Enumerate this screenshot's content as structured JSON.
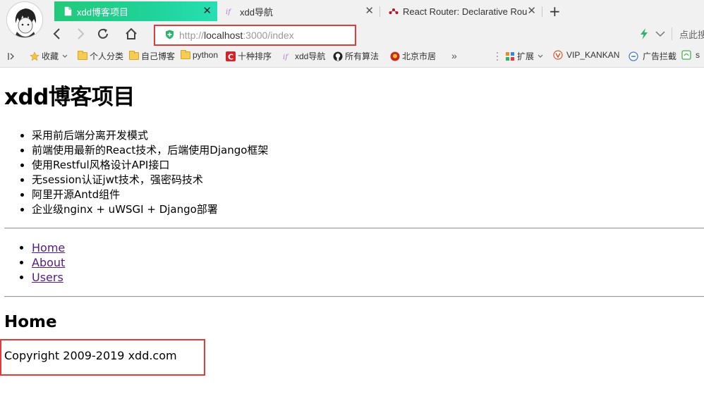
{
  "browser": {
    "tabs": [
      {
        "label": "xdd博客项目",
        "active": true
      },
      {
        "label": "xdd导航",
        "active": false
      },
      {
        "label": "React Router: Declarative Rou",
        "active": false
      }
    ],
    "tab_close_glyph": "✕",
    "new_tab_glyph": "+",
    "address": {
      "scheme": "http://",
      "host": "localhost",
      "rest": ":3000/index"
    },
    "search_hint": "点此搜",
    "bookmarks": [
      {
        "label": "收藏",
        "icon": "star-icon"
      },
      {
        "label": "个人分类",
        "icon": "folder-icon"
      },
      {
        "label": "自己博客",
        "icon": "folder-icon"
      },
      {
        "label": "python",
        "icon": "folder-icon"
      },
      {
        "label": "十种排序",
        "icon": "c-logo-icon"
      },
      {
        "label": "xdd导航",
        "icon": "if-logo-icon"
      },
      {
        "label": "所有算法",
        "icon": "github-icon"
      },
      {
        "label": "北京市居",
        "icon": "emblem-icon"
      },
      {
        "label": "»",
        "icon": "more-icon"
      },
      {
        "label": "扩展",
        "icon": "extensions-icon"
      },
      {
        "label": "VIP_KANKAN",
        "icon": "v-icon"
      },
      {
        "label": "广告拦截",
        "icon": "adblock-icon"
      },
      {
        "label": "s",
        "icon": "green-ext-icon"
      }
    ],
    "colors": {
      "active_tab": "#22c97a",
      "highlight_box": "#e33a3a",
      "visited_link": "#551a8b"
    }
  },
  "page": {
    "title": "xdd博客项目",
    "features": [
      "采用前后端分离开发模式",
      "前端使用最新的React技术，后端使用Django框架",
      "使用Restful风格设计API接口",
      "无session认证jwt技术，强密码技术",
      "阿里开源Antd组件",
      "企业级nginx + uWSGI + Django部署"
    ],
    "nav_links": [
      "Home",
      "About",
      "Users"
    ],
    "route_title": "Home",
    "footer": "Copyright 2009-2019 xdd.com"
  }
}
